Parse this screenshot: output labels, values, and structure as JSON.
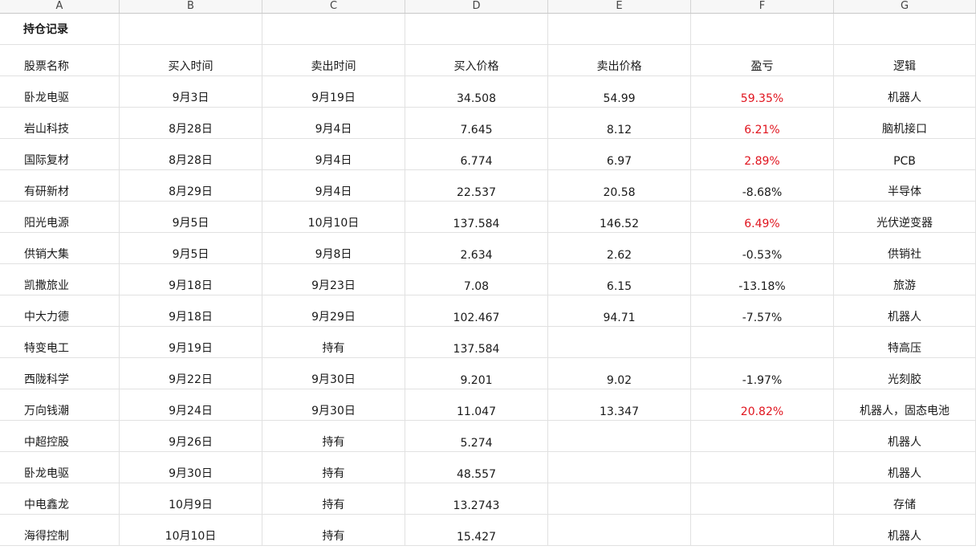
{
  "columns": [
    "A",
    "B",
    "C",
    "D",
    "E",
    "F",
    "G"
  ],
  "title": "持仓记录",
  "headers": [
    "股票名称",
    "买入时间",
    "卖出时间",
    "买入价格",
    "卖出价格",
    "盈亏",
    "逻辑"
  ],
  "rows": [
    [
      "卧龙电驱",
      "9月3日",
      "9月19日",
      "34.508",
      "54.99",
      "59.35%",
      "机器人"
    ],
    [
      "岩山科技",
      "8月28日",
      "9月4日",
      "7.645",
      "8.12",
      "6.21%",
      "脑机接口"
    ],
    [
      "国际复材",
      "8月28日",
      "9月4日",
      "6.774",
      "6.97",
      "2.89%",
      "PCB"
    ],
    [
      "有研新材",
      "8月29日",
      "9月4日",
      "22.537",
      "20.58",
      "-8.68%",
      "半导体"
    ],
    [
      "阳光电源",
      "9月5日",
      "10月10日",
      "137.584",
      "146.52",
      "6.49%",
      "光伏逆变器"
    ],
    [
      "供销大集",
      "9月5日",
      "9月8日",
      "2.634",
      "2.62",
      "-0.53%",
      "供销社"
    ],
    [
      "凯撒旅业",
      "9月18日",
      "9月23日",
      "7.08",
      "6.15",
      "-13.18%",
      "旅游"
    ],
    [
      "中大力德",
      "9月18日",
      "9月29日",
      "102.467",
      "94.71",
      "-7.57%",
      "机器人"
    ],
    [
      "特变电工",
      "9月19日",
      "持有",
      "137.584",
      "",
      "",
      "特高压"
    ],
    [
      "西陇科学",
      "9月22日",
      "9月30日",
      "9.201",
      "9.02",
      "-1.97%",
      "光刻胶"
    ],
    [
      "万向钱潮",
      "9月24日",
      "9月30日",
      "11.047",
      "13.347",
      "20.82%",
      "机器人，固态电池"
    ],
    [
      "中超控股",
      "9月26日",
      "持有",
      "5.274",
      "",
      "",
      "机器人"
    ],
    [
      "卧龙电驱",
      "9月30日",
      "持有",
      "48.557",
      "",
      "",
      "机器人"
    ],
    [
      "中电鑫龙",
      "10月9日",
      "持有",
      "13.2743",
      "",
      "",
      "存储"
    ],
    [
      "海得控制",
      "10月10日",
      "持有",
      "15.427",
      "",
      "",
      "机器人"
    ]
  ],
  "colors": {
    "profit": "#e0141e",
    "loss": "#1a1a1a"
  }
}
